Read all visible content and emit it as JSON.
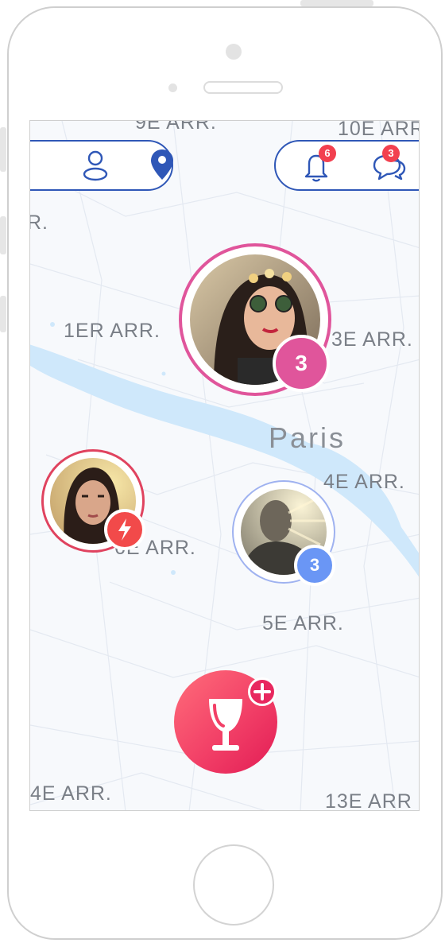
{
  "map": {
    "city_label": "Paris",
    "districts": [
      "9E ARR.",
      "10E ARR",
      "R.",
      "1ER ARR.",
      "3E ARR.",
      "4E ARR.",
      "6E ARR.",
      "5E ARR.",
      "4E ARR.",
      "13E ARR"
    ]
  },
  "top_bar": {
    "left_icons": [
      "person-icon",
      "location-pin-icon"
    ],
    "notifications_count": "6",
    "messages_count": "3"
  },
  "markers": [
    {
      "name": "marker-top",
      "count": "3",
      "ring_color": "#e0559b"
    },
    {
      "name": "marker-left",
      "badge_icon": "lightning-icon",
      "ring_color": "#e0435f"
    },
    {
      "name": "marker-right",
      "count": "3",
      "ring_color": "#9fb2f0"
    }
  ],
  "fab": {
    "icon": "wine-glass-icon",
    "plus_icon": "plus-icon"
  },
  "colors": {
    "accent_blue": "#2f57b7",
    "river": "#cfe8fb",
    "pink": "#e0559b",
    "red": "#f2404f",
    "blue_badge": "#6a96f5"
  }
}
